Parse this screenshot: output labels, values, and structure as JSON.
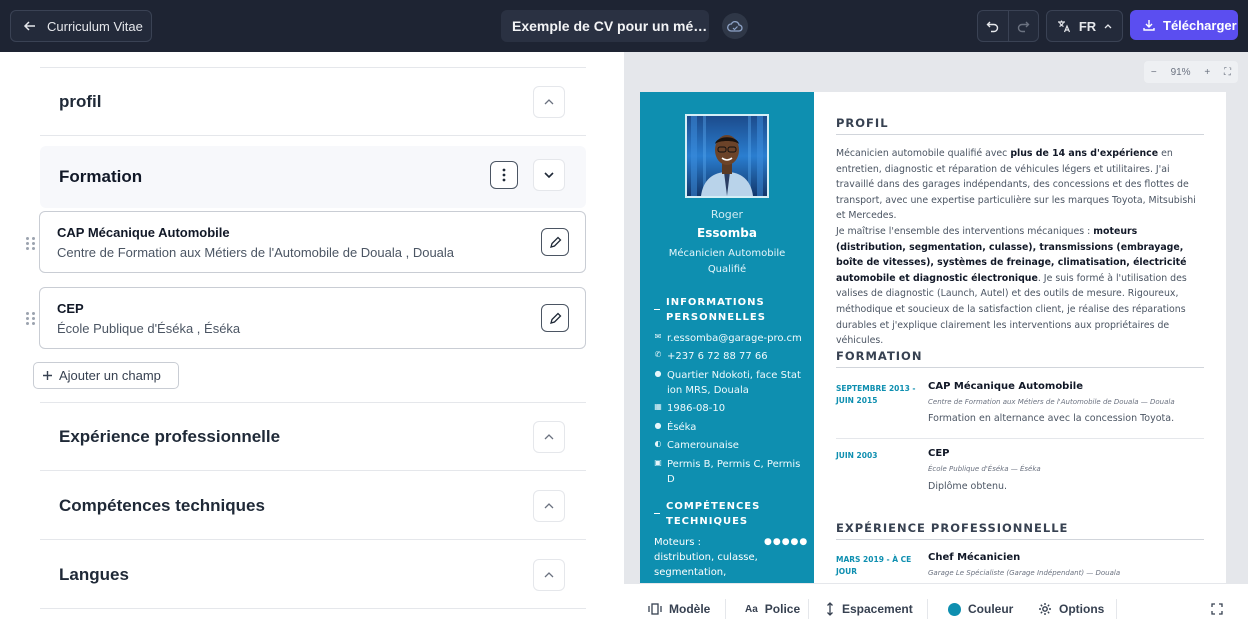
{
  "header": {
    "back_label": "Curriculum Vitae",
    "doc_title": "Exemple de CV pour un mé…",
    "lang": "FR",
    "download_label": "Télécharger"
  },
  "editor": {
    "sections_top": [
      "profil"
    ],
    "formation": {
      "title": "Formation",
      "entries": [
        {
          "title": "CAP Mécanique Automobile",
          "subtitle": "Centre de Formation aux Métiers de l'Automobile de Douala , Douala"
        },
        {
          "title": "CEP",
          "subtitle": "École Publique d'Éséka , Éséka"
        }
      ],
      "add_label": "Ajouter un champ"
    },
    "sections_bottom": [
      "Expérience professionnelle",
      "Compétences techniques",
      "Langues"
    ]
  },
  "preview": {
    "zoom": "91%",
    "first_name": "Roger",
    "last_name": "Essomba",
    "job_title": "Mécanicien Automobile Qualifié",
    "info_heading_1": "INFORMATIONS",
    "info_heading_2": "PERSONNELLES",
    "info": [
      {
        "icon": "mail-icon",
        "lines": [
          "r.essomba@garage-pro.cm"
        ]
      },
      {
        "icon": "phone-icon",
        "lines": [
          "+237 6 72 88 77 66"
        ]
      },
      {
        "icon": "location-icon",
        "lines": [
          "Quartier Ndokoti, face Stat",
          "ion MRS, Douala"
        ]
      },
      {
        "icon": "calendar-icon",
        "lines": [
          "1986-08-10"
        ]
      },
      {
        "icon": "pin-icon",
        "lines": [
          "Éséka"
        ]
      },
      {
        "icon": "globe-icon",
        "lines": [
          "Camerounaise"
        ]
      },
      {
        "icon": "id-card-icon",
        "lines": [
          "Permis B, Permis C, Permis",
          "D"
        ]
      }
    ],
    "skills_heading_1": "COMPÉTENCES",
    "skills_heading_2": "TECHNIQUES",
    "skill_1": "Moteurs :",
    "skill_2": "distribution, culasse,",
    "skill_3": "segmentation,",
    "skill_rating": "●●●●●",
    "profil_heading": "PROFIL",
    "profil_p1": [
      "Mécanicien automobile qualifié avec ",
      "plus de 14 ans d'expérience",
      " en entretien, diagnostic et réparation de véhicules légers et utilitaires. J'ai travaillé dans des garages indépendants, des concessions et des flottes de transport, avec une expertise particulière sur les marques Toyota, Mitsubishi et Mercedes."
    ],
    "profil_p2": [
      "Je maîtrise l'ensemble des interventions mécaniques : ",
      "moteurs (distribution, segmentation, culasse), transmissions (embrayage, boîte de vitesses), systèmes de freinage, climatisation, électricité automobile et diagnostic électronique",
      ". Je suis formé à l'utilisation des valises de diagnostic (Launch, Autel) et des outils de mesure. Rigoureux, méthodique et soucieux de la satisfaction client, je réalise des réparations durables et j'explique clairement les interventions aux propriétaires de véhicules."
    ],
    "formation_heading": "FORMATION",
    "formation": [
      {
        "date_1": "SEPTEMBRE 2013 -",
        "date_2": "JUIN 2015",
        "title": "CAP Mécanique Automobile",
        "school": "Centre de Formation aux Métiers de l'Automobile de Douala — Douala",
        "desc": "Formation en alternance avec la concession Toyota."
      },
      {
        "date_1": "JUIN 2003",
        "date_2": "",
        "title": "CEP",
        "school": "École Publique d'Éséka — Éséka",
        "desc": "Diplôme obtenu."
      }
    ],
    "exp_heading": "EXPÉRIENCE PROFESSIONNELLE",
    "exp_date_1": "MARS 2019 - À CE",
    "exp_date_2": "JOUR",
    "exp_title": "Chef Mécanicien",
    "exp_company": "Garage Le Spécialiste (Garage Indépendant) — Douala"
  },
  "toolbar": {
    "model": "Modèle",
    "font": "Police",
    "spacing": "Espacement",
    "color": "Couleur",
    "options": "Options",
    "accent_color": "#0e8fb0"
  }
}
